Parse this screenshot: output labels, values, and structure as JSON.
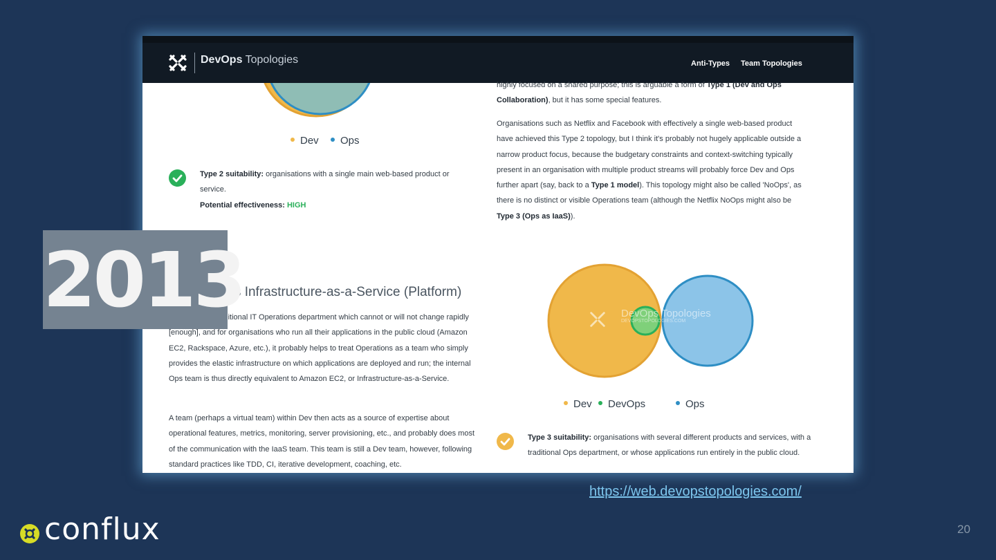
{
  "navbar": {
    "brand_bold": "DevOps",
    "brand_light": "Topologies",
    "links": [
      "Anti-Types",
      "Team Topologies"
    ]
  },
  "left_column": {
    "legend_top": [
      "Dev",
      "Ops"
    ],
    "type2": {
      "label": "Type 2 suitability:",
      "text": "organisations with a single main web-based product or service.",
      "effectiveness_label": "Potential effectiveness:",
      "effectiveness_value": "HIGH"
    },
    "section_heading": "ps as Infrastructure-as-a-Service (Platform)",
    "para1": "s with a fairly traditional IT Operations department which cannot or will not change rapidly [enough], and for organisations who run all their applications in the public cloud (Amazon EC2, Rackspace, Azure, etc.), it probably helps to treat Operations as a team who simply provides the elastic infrastructure on which applications are deployed and run; the internal Ops team is thus directly equivalent to Amazon EC2, or Infrastructure-as-a-Service.",
    "para2": "A team (perhaps a virtual team) within Dev then acts as a source of expertise about operational features, metrics, monitoring, server provisioning, etc., and probably does most of the communication with the IaaS team. This team is still a Dev team, however, following standard practices like TDD, CI, iterative development, coaching, etc."
  },
  "right_column": {
    "para0_a": "highly focused on a shared purpose; this is arguable a form of ",
    "para0_b": "Type 1 (Dev and Ops Collaboration)",
    "para0_c": ", but it has some special features.",
    "para1_a": "Organisations such as Netflix and Facebook with effectively a single web-based product have achieved this Type 2 topology, but I think it's probably not hugely applicable outside a narrow product focus, because the budgetary constraints and context-switching typically present in an organisation with multiple product streams will probably force Dev and Ops further apart (say, back to a ",
    "para1_b": "Type 1 model",
    "para1_c": "). This topology might also be called 'NoOps', as there is no distinct or visible Operations team (although the Netflix NoOps might also be ",
    "para1_d": "Type 3 (Ops as IaaS)",
    "para1_e": ").",
    "legend_bottom": [
      "Dev",
      "DevOps",
      "Ops"
    ],
    "type3": {
      "label": "Type 3 suitability:",
      "text": "organisations with several different products and services, with a traditional Ops department, or whose applications run entirely in the public cloud."
    },
    "watermark_name": "DevOps Topologies",
    "watermark_url": "DEVOPSTOPOLOGIES.COM"
  },
  "overlay": {
    "year": "2013",
    "url": "https://web.devopstopologies.com/",
    "brand": "conflux",
    "page_number": "20"
  },
  "colors": {
    "background": "#1d3557",
    "dev": "#f0b84a",
    "ops": "#2e8ec4",
    "devops": "#2ab05a",
    "nav": "#111a24"
  },
  "icons": {
    "nav_logo": "devops-topologies-logo-icon",
    "check": "check-circle-icon",
    "conflux_mark": "conflux-logo-icon"
  }
}
